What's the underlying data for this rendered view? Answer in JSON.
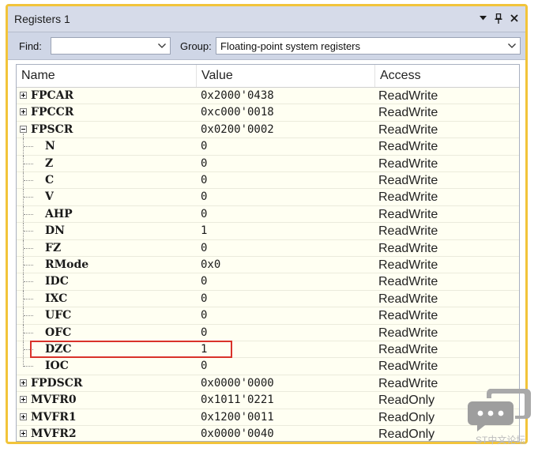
{
  "window": {
    "title": "Registers 1"
  },
  "title_controls": [
    "dropdown-icon",
    "pin-icon",
    "close-icon"
  ],
  "toolbar": {
    "find_label": "Find:",
    "find_value": "",
    "group_label": "Group:",
    "group_value": "Floating-point system registers"
  },
  "columns": [
    "Name",
    "Value",
    "Access"
  ],
  "rows": [
    {
      "name": "FPCAR",
      "value": "0x2000'0438",
      "access": "ReadWrite",
      "level": 0,
      "expander": "plus"
    },
    {
      "name": "FPCCR",
      "value": "0xc000'0018",
      "access": "ReadWrite",
      "level": 0,
      "expander": "plus"
    },
    {
      "name": "FPSCR",
      "value": "0x0200'0002",
      "access": "ReadWrite",
      "level": 0,
      "expander": "minus"
    },
    {
      "name": "N",
      "value": "0",
      "access": "ReadWrite",
      "level": 1
    },
    {
      "name": "Z",
      "value": "0",
      "access": "ReadWrite",
      "level": 1
    },
    {
      "name": "C",
      "value": "0",
      "access": "ReadWrite",
      "level": 1
    },
    {
      "name": "V",
      "value": "0",
      "access": "ReadWrite",
      "level": 1
    },
    {
      "name": "AHP",
      "value": "0",
      "access": "ReadWrite",
      "level": 1
    },
    {
      "name": "DN",
      "value": "1",
      "access": "ReadWrite",
      "level": 1
    },
    {
      "name": "FZ",
      "value": "0",
      "access": "ReadWrite",
      "level": 1
    },
    {
      "name": "RMode",
      "value": "0x0",
      "access": "ReadWrite",
      "level": 1
    },
    {
      "name": "IDC",
      "value": "0",
      "access": "ReadWrite",
      "level": 1
    },
    {
      "name": "IXC",
      "value": "0",
      "access": "ReadWrite",
      "level": 1
    },
    {
      "name": "UFC",
      "value": "0",
      "access": "ReadWrite",
      "level": 1
    },
    {
      "name": "OFC",
      "value": "0",
      "access": "ReadWrite",
      "level": 1
    },
    {
      "name": "DZC",
      "value": "1",
      "access": "ReadWrite",
      "level": 1,
      "highlighted": true
    },
    {
      "name": "IOC",
      "value": "0",
      "access": "ReadWrite",
      "level": 1,
      "last_child": true
    },
    {
      "name": "FPDSCR",
      "value": "0x0000'0000",
      "access": "ReadWrite",
      "level": 0,
      "expander": "plus"
    },
    {
      "name": "MVFR0",
      "value": "0x1011'0221",
      "access": "ReadOnly",
      "level": 0,
      "expander": "plus"
    },
    {
      "name": "MVFR1",
      "value": "0x1200'0011",
      "access": "ReadOnly",
      "level": 0,
      "expander": "plus"
    },
    {
      "name": "MVFR2",
      "value": "0x0000'0040",
      "access": "ReadOnly",
      "level": 0,
      "expander": "plus"
    }
  ],
  "highlight_color": "#d9322a",
  "watermark": {
    "text": "ST中文论坛",
    "icon": "chat-bubbles-icon"
  }
}
